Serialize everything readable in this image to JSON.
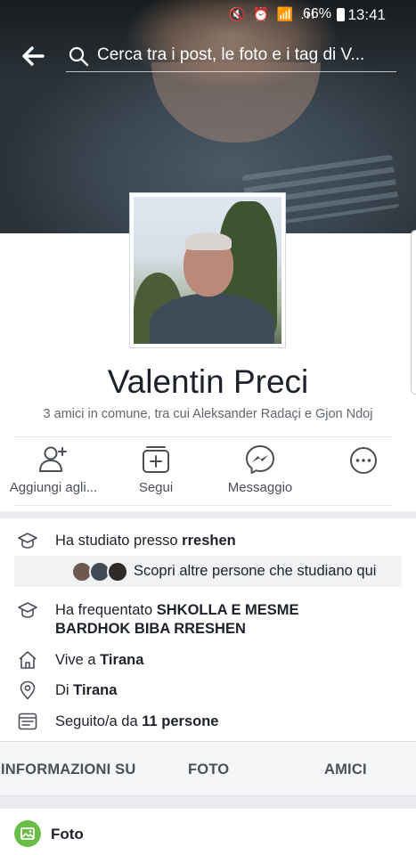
{
  "status_bar": {
    "icons": "🔇 ⏰ 📶 .ıl",
    "battery": "66%",
    "time": "13:41"
  },
  "search": {
    "back_icon": "back-arrow-icon",
    "placeholder": "Cerca tra i post, le foto e i tag di V..."
  },
  "profile": {
    "name": "Valentin Preci",
    "mutual_friends": "3 amici in comune, tra cui Aleksander Radaçi e Gjon Ndoj"
  },
  "actions": [
    {
      "label": "Aggiungi agli...",
      "icon": "add-friend-icon"
    },
    {
      "label": "Segui",
      "icon": "follow-icon"
    },
    {
      "label": "Messaggio",
      "icon": "messenger-icon"
    },
    {
      "label": "",
      "icon": "more-icon"
    }
  ],
  "info": {
    "studied_prefix": "Ha studiato presso ",
    "studied_place": "rreshen",
    "discover_text": "Scopri altre persone che studiano qui",
    "attended_prefix": "Ha frequentato ",
    "attended_school": "SHKOLLA E MESME BARDHOK BIBA RRESHEN",
    "lives_prefix": "Vive a ",
    "lives_city": "Tirana",
    "from_prefix": "Di ",
    "from_city": "Tirana",
    "followers_prefix": "Seguito/a da ",
    "followers_count": "11 persone"
  },
  "tabs": [
    "INFORMAZIONI SU",
    "FOTO",
    "AMICI"
  ],
  "photos_section": {
    "label": "Foto"
  },
  "colors": {
    "accent": "#4b4f56",
    "photo_green": "#6bbd45",
    "separator": "#e9ebee"
  }
}
